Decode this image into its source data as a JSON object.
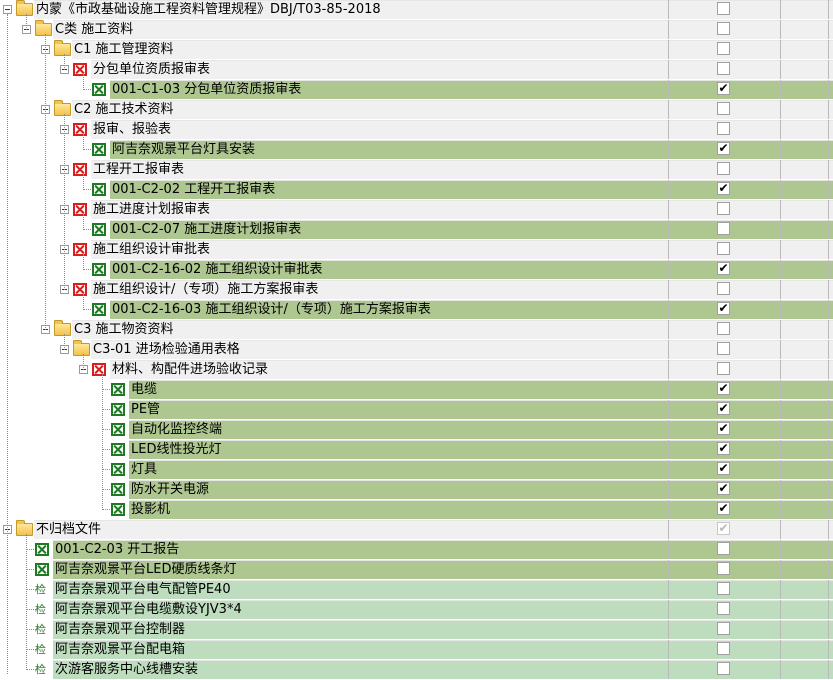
{
  "rows": [
    {
      "text": "内蒙《市政基础设施工程资料管理规程》DBJ/T03-85-2018",
      "level": 0,
      "type": "folder",
      "expander": true,
      "check": "empty"
    },
    {
      "text": "C类 施工资料",
      "level": 1,
      "type": "folder",
      "expander": true,
      "check": "empty"
    },
    {
      "text": "C1 施工管理资料",
      "level": 2,
      "type": "folder",
      "expander": true,
      "check": "empty"
    },
    {
      "text": "分包单位资质报审表",
      "level": 3,
      "type": "red",
      "expander": true,
      "check": "empty"
    },
    {
      "text": "001-C1-03 分包单位资质报审表",
      "level": 4,
      "type": "green",
      "expander": false,
      "check": "checked"
    },
    {
      "text": "C2 施工技术资料",
      "level": 2,
      "type": "folder",
      "expander": true,
      "check": "empty"
    },
    {
      "text": "报审、报验表",
      "level": 3,
      "type": "red",
      "expander": true,
      "check": "empty"
    },
    {
      "text": "阿吉奈观景平台灯具安装",
      "level": 4,
      "type": "green",
      "expander": false,
      "check": "checked"
    },
    {
      "text": "工程开工报审表",
      "level": 3,
      "type": "red",
      "expander": true,
      "check": "empty"
    },
    {
      "text": "001-C2-02 工程开工报审表",
      "level": 4,
      "type": "green",
      "expander": false,
      "check": "checked"
    },
    {
      "text": "施工进度计划报审表",
      "level": 3,
      "type": "red",
      "expander": true,
      "check": "empty"
    },
    {
      "text": "001-C2-07 施工进度计划报审表",
      "level": 4,
      "type": "green",
      "expander": false,
      "check": "empty"
    },
    {
      "text": "施工组织设计审批表",
      "level": 3,
      "type": "red",
      "expander": true,
      "check": "empty"
    },
    {
      "text": "001-C2-16-02 施工组织设计审批表",
      "level": 4,
      "type": "green",
      "expander": false,
      "check": "checked"
    },
    {
      "text": "施工组织设计/（专项）施工方案报审表",
      "level": 3,
      "type": "red",
      "expander": true,
      "check": "empty"
    },
    {
      "text": "001-C2-16-03 施工组织设计/（专项）施工方案报审表",
      "level": 4,
      "type": "green",
      "expander": false,
      "check": "checked"
    },
    {
      "text": "C3 施工物资资料",
      "level": 2,
      "type": "folder",
      "expander": true,
      "check": "empty"
    },
    {
      "text": "C3-01 进场检验通用表格",
      "level": 3,
      "type": "folder",
      "expander": true,
      "check": "empty"
    },
    {
      "text": "材料、构配件进场验收记录",
      "level": 4,
      "type": "red",
      "expander": true,
      "check": "empty"
    },
    {
      "text": "电缆",
      "level": 5,
      "type": "green",
      "expander": false,
      "check": "checked"
    },
    {
      "text": "PE管",
      "level": 5,
      "type": "green",
      "expander": false,
      "check": "checked"
    },
    {
      "text": "自动化监控终端",
      "level": 5,
      "type": "green",
      "expander": false,
      "check": "checked"
    },
    {
      "text": "LED线性投光灯",
      "level": 5,
      "type": "green",
      "expander": false,
      "check": "checked"
    },
    {
      "text": "灯具",
      "level": 5,
      "type": "green",
      "expander": false,
      "check": "checked"
    },
    {
      "text": "防水开关电源",
      "level": 5,
      "type": "green",
      "expander": false,
      "check": "checked"
    },
    {
      "text": "投影机",
      "level": 5,
      "type": "green",
      "expander": false,
      "check": "checked"
    },
    {
      "text": "不归档文件",
      "level": 0,
      "type": "folder",
      "expander": true,
      "check": "disabled"
    },
    {
      "text": "001-C2-03 开工报告",
      "level": 1,
      "type": "green",
      "expander": false,
      "check": "empty"
    },
    {
      "text": "阿吉奈观景平台LED硬质线条灯",
      "level": 1,
      "type": "green",
      "expander": false,
      "check": "empty"
    },
    {
      "text": "阿吉奈景观平台电气配管PE40",
      "level": 1,
      "type": "jian",
      "icon_text": "检",
      "expander": false,
      "check": "empty"
    },
    {
      "text": "阿吉奈景观平台电缆敷设YJV3*4",
      "level": 1,
      "type": "jian",
      "icon_text": "检",
      "expander": false,
      "check": "empty"
    },
    {
      "text": "阿吉奈景观平台控制器",
      "level": 1,
      "type": "jian",
      "icon_text": "检",
      "expander": false,
      "check": "empty"
    },
    {
      "text": "阿吉奈观景平台配电箱",
      "level": 1,
      "type": "jian",
      "icon_text": "检",
      "expander": false,
      "check": "empty"
    },
    {
      "text": "次游客服务中心线槽安装",
      "level": 1,
      "type": "jian",
      "icon_text": "检",
      "expander": false,
      "check": "empty"
    }
  ]
}
